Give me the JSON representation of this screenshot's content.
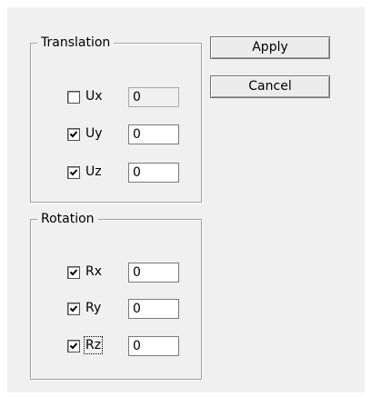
{
  "translation": {
    "title": "Translation",
    "rows": [
      {
        "label": "Ux",
        "checked": false,
        "value": "0",
        "enabled": false
      },
      {
        "label": "Uy",
        "checked": true,
        "value": "0",
        "enabled": true
      },
      {
        "label": "Uz",
        "checked": true,
        "value": "0",
        "enabled": true
      }
    ]
  },
  "rotation": {
    "title": "Rotation",
    "rows": [
      {
        "label": "Rx",
        "checked": true,
        "value": "0",
        "enabled": true
      },
      {
        "label": "Ry",
        "checked": true,
        "value": "0",
        "enabled": true
      },
      {
        "label": "Rz",
        "checked": true,
        "value": "0",
        "enabled": true
      }
    ]
  },
  "buttons": {
    "apply": "Apply",
    "cancel": "Cancel"
  }
}
